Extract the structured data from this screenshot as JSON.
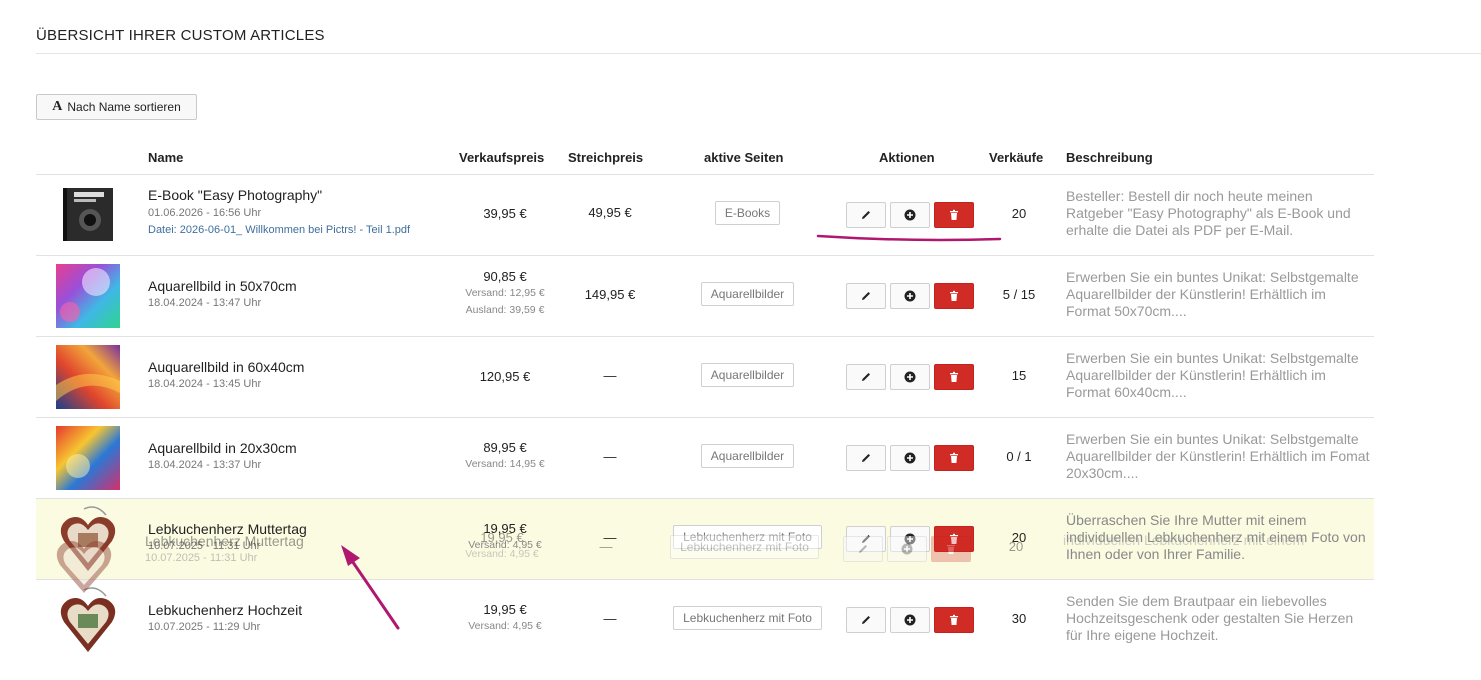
{
  "page": {
    "title": "ÜBERSICHT IHRER CUSTOM ARTICLES"
  },
  "toolbar": {
    "sort_icon": "A",
    "sort_label": "Nach Name sortieren"
  },
  "headers": {
    "name": "Name",
    "price": "Verkaufspreis",
    "strike": "Streichpreis",
    "pages": "aktive Seiten",
    "actions": "Aktionen",
    "sales": "Verkäufe",
    "description": "Beschreibung"
  },
  "rows": [
    {
      "name": "E-Book \"Easy Photography\"",
      "date": "01.06.2026 - 16:56 Uhr",
      "file": "Datei: 2026-06-01_ Willkommen bei Pictrs! - Teil 1.pdf",
      "price": "39,95 €",
      "price_sub1": "",
      "price_sub2": "",
      "strike": "49,95 €",
      "page": "E-Books",
      "sales": "20",
      "desc": "Besteller: Bestell dir noch heute meinen Ratgeber \"Easy Photography\" als E-Book und erhalte die Datei als PDF per E-Mail.",
      "thumb_icon": "ebook-cover-icon"
    },
    {
      "name": "Aquarellbild in 50x70cm",
      "date": "18.04.2024 - 13:47 Uhr",
      "file": "",
      "price": "90,85 €",
      "price_sub1": "Versand: 12,95 €",
      "price_sub2": "Ausland: 39,59 €",
      "strike": "149,95 €",
      "page": "Aquarellbilder",
      "sales": "5 / 15",
      "desc": "Erwerben Sie ein buntes Unikat: Selbstgemalte Aquarellbilder der Künstlerin! Erhältlich im Format 50x70cm....",
      "thumb_icon": "watercolor-thumb-icon"
    },
    {
      "name": "Auquarellbild in 60x40cm",
      "date": "18.04.2024 - 13:45 Uhr",
      "file": "",
      "price": "120,95 €",
      "price_sub1": "",
      "price_sub2": "",
      "strike": "—",
      "page": "Aquarellbilder",
      "sales": "15",
      "desc": "Erwerben Sie ein buntes Unikat: Selbstgemalte Aquarellbilder der Künstlerin! Erhältlich im Format 60x40cm....",
      "thumb_icon": "watercolor-thumb-icon"
    },
    {
      "name": "Aquarellbild in 20x30cm",
      "date": "18.04.2024 - 13:37 Uhr",
      "file": "",
      "price": "89,95 €",
      "price_sub1": "Versand: 14,95 €",
      "price_sub2": "",
      "strike": "—",
      "page": "Aquarellbilder",
      "sales": "0 / 1",
      "desc": "Erwerben Sie ein buntes Unikat: Selbstgemalte Aquarellbilder der Künstlerin! Erhältlich im Fomat 20x30cm....",
      "thumb_icon": "watercolor-thumb-icon"
    },
    {
      "name": "Lebkuchenherz Muttertag",
      "date": "10.07.2025 - 11:31 Uhr",
      "file": "",
      "price": "19,95 €",
      "price_sub1": "Versand: 4,95 €",
      "price_sub2": "",
      "strike": "—",
      "page": "Lebkuchenherz mit Foto",
      "sales": "20",
      "desc": "Überraschen Sie Ihre Mutter mit einem individuellen Lebkuchenherz mit einem Foto von Ihnen oder von Ihrer Familie.",
      "thumb_icon": "gingerbread-heart-icon"
    },
    {
      "name": "Lebkuchenherz Hochzeit",
      "date": "10.07.2025 - 11:29 Uhr",
      "file": "",
      "price": "19,95 €",
      "price_sub1": "Versand: 4,95 €",
      "price_sub2": "",
      "strike": "—",
      "page": "Lebkuchenherz mit Foto",
      "sales": "30",
      "desc": "Senden Sie dem Brautpaar ein liebevolles Hochzeitsgeschenk oder gestalten Sie Herzen für Ihre eigene Hochzeit.",
      "thumb_icon": "gingerbread-heart-icon"
    }
  ],
  "drag_ghost": {
    "name": "Lebkuchenherz Muttertag",
    "date": "10.07.2025 - 11:31 Uhr",
    "price": "19,95 €",
    "price_sub1": "Versand: 4,95 €",
    "strike": "—",
    "page": "Lebkuchenherz mit Foto",
    "sales": "20",
    "desc": "individuellen Lebkuchenherz mit einem"
  },
  "icons": {
    "edit": "pencil-icon",
    "add": "plus-circle-icon",
    "delete": "trash-icon"
  },
  "colors": {
    "delete": "#d02b25",
    "highlight_row": "#fbfbe2",
    "annotation": "#b0186f",
    "file_link": "#3f6f9e"
  }
}
